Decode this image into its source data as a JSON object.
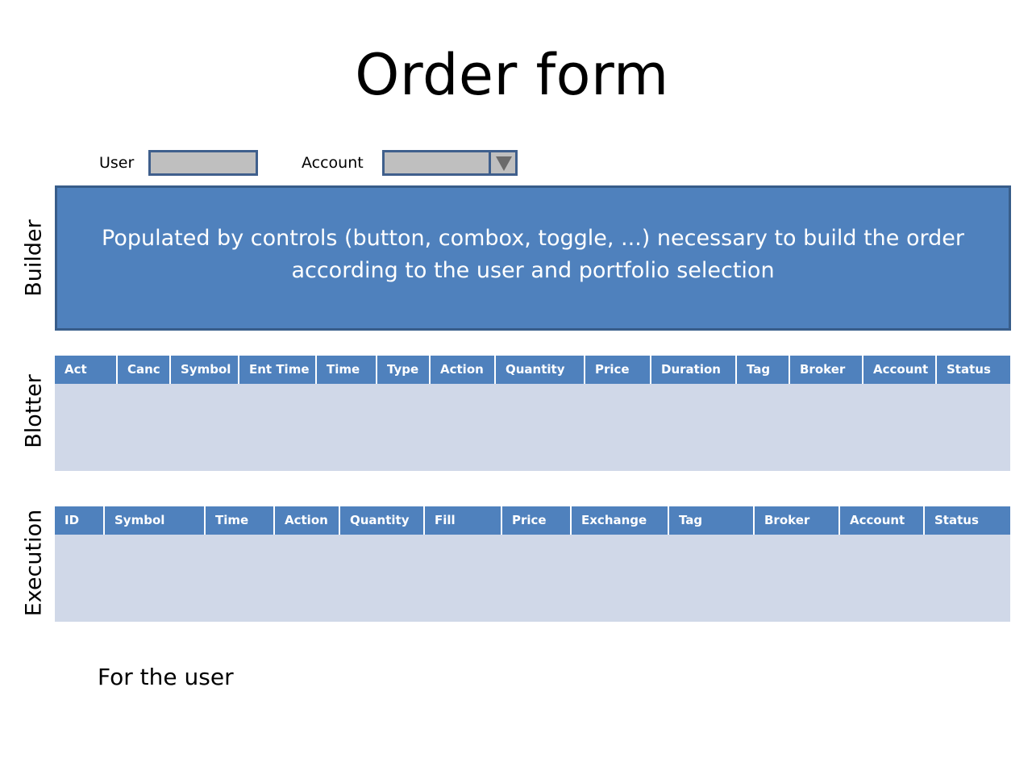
{
  "title": "Order form",
  "user": {
    "label": "User",
    "value": ""
  },
  "account": {
    "label": "Account",
    "selected": ""
  },
  "sections": {
    "builder": "Builder",
    "blotter": "Blotter",
    "execution": "Execution"
  },
  "builder_panel": {
    "text": "Populated by controls (button, combox, toggle, ...) necessary to build the order according to the user and portfolio selection"
  },
  "blotter": {
    "columns": [
      "Act",
      "Canc",
      "Symbol",
      "Ent Time",
      "Time",
      "Type",
      "Action",
      "Quantity",
      "Price",
      "Duration",
      "Tag",
      "Broker",
      "Account",
      "Status"
    ]
  },
  "execution": {
    "columns": [
      "ID",
      "Symbol",
      "Time",
      "Action",
      "Quantity",
      "Fill",
      "Price",
      "Exchange",
      "Tag",
      "Broker",
      "Account",
      "Status"
    ]
  },
  "footer": "For the user",
  "colors": {
    "panel": "#4f81bd",
    "panel_border": "#385d8a",
    "grid_body": "#d0d8e8",
    "input_fill": "#bfbfbf"
  },
  "icons": {
    "account_dropdown": "chevron-down-icon"
  }
}
